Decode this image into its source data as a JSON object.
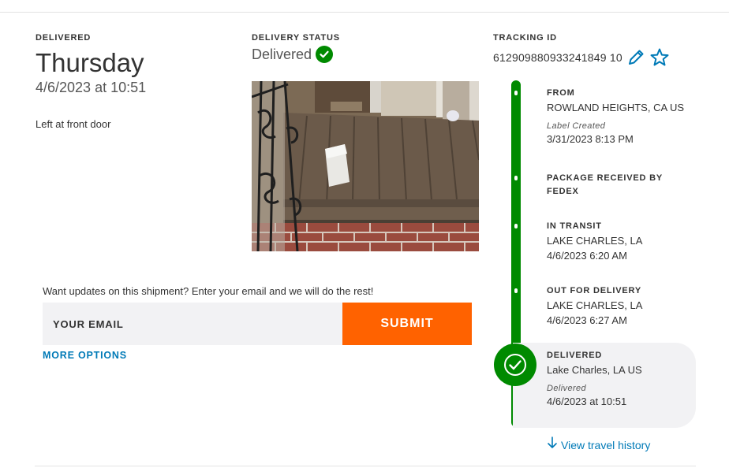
{
  "delivered": {
    "heading": "DELIVERED",
    "day": "Thursday",
    "datetime": "4/6/2023 at 10:51",
    "note": "Left at front door"
  },
  "status": {
    "heading": "DELIVERY STATUS",
    "text": "Delivered",
    "icon": "check-circle-icon"
  },
  "photo": {
    "icon": "proof-of-delivery-photo"
  },
  "email": {
    "prompt": "Want updates on this shipment? Enter your email and we will do the rest!",
    "placeholder": "YOUR EMAIL",
    "value": "",
    "submit_label": "SUBMIT",
    "more_options_label": "MORE OPTIONS"
  },
  "tracking": {
    "heading": "TRACKING ID",
    "number": "612909880933241849 10",
    "edit_icon": "pencil-icon",
    "watch_icon": "star-icon"
  },
  "timeline": {
    "events": [
      {
        "title": "FROM",
        "line1": "ROWLAND HEIGHTS, CA US",
        "note": "Label Created",
        "line2": "3/31/2023 8:13 PM"
      },
      {
        "title": "PACKAGE RECEIVED BY",
        "line1": "FEDEX"
      },
      {
        "title": "IN TRANSIT",
        "line1": "LAKE CHARLES, LA",
        "line2": "4/6/2023 6:20 AM"
      },
      {
        "title": "OUT FOR DELIVERY",
        "line1": "LAKE CHARLES, LA",
        "line2": "4/6/2023 6:27 AM"
      },
      {
        "title": "DELIVERED",
        "line1": "Lake Charles, LA US",
        "note": "Delivered",
        "line2": "4/6/2023 at 10:51"
      }
    ],
    "history_label": "View travel history",
    "history_icon": "arrow-down-icon"
  },
  "colors": {
    "green": "#008a00",
    "orange": "#ff6200",
    "link_blue": "#007ab7"
  }
}
